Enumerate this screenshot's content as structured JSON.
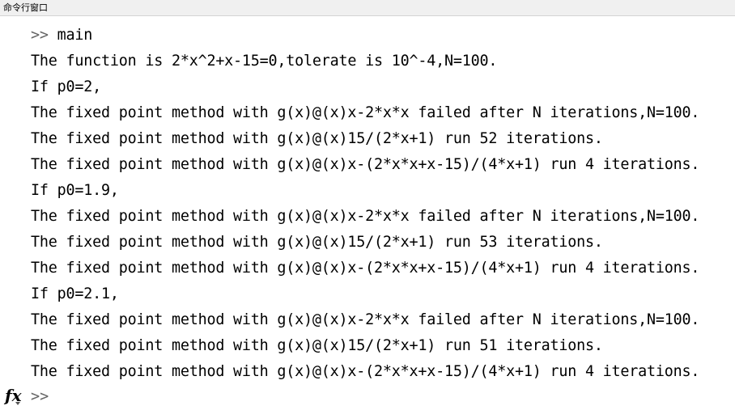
{
  "window": {
    "title": "命令行窗口"
  },
  "console": {
    "command_prompt": ">>",
    "command": " main",
    "output_lines": [
      "The function is 2*x^2+x-15=0,tolerate is 10^-4,N=100.",
      "If p0=2,",
      "The fixed point method with g(x)@(x)x-2*x*x failed after N iterations,N=100.",
      "The fixed point method with g(x)@(x)15/(2*x+1) run 52 iterations.",
      "The fixed point method with g(x)@(x)x-(2*x*x+x-15)/(4*x+1) run 4 iterations.",
      "If p0=1.9,",
      "The fixed point method with g(x)@(x)x-2*x*x failed after N iterations,N=100.",
      "The fixed point method with g(x)@(x)15/(2*x+1) run 53 iterations.",
      "The fixed point method with g(x)@(x)x-(2*x*x+x-15)/(4*x+1) run 4 iterations.",
      "If p0=2.1,",
      "The fixed point method with g(x)@(x)x-2*x*x failed after N iterations,N=100.",
      "The fixed point method with g(x)@(x)15/(2*x+1) run 51 iterations.",
      "The fixed point method with g(x)@(x)x-(2*x*x+x-15)/(4*x+1) run 4 iterations."
    ],
    "input_prompt": ">>",
    "function_browser_label": "fx",
    "function_browser_icon": "function-browser-icon"
  }
}
